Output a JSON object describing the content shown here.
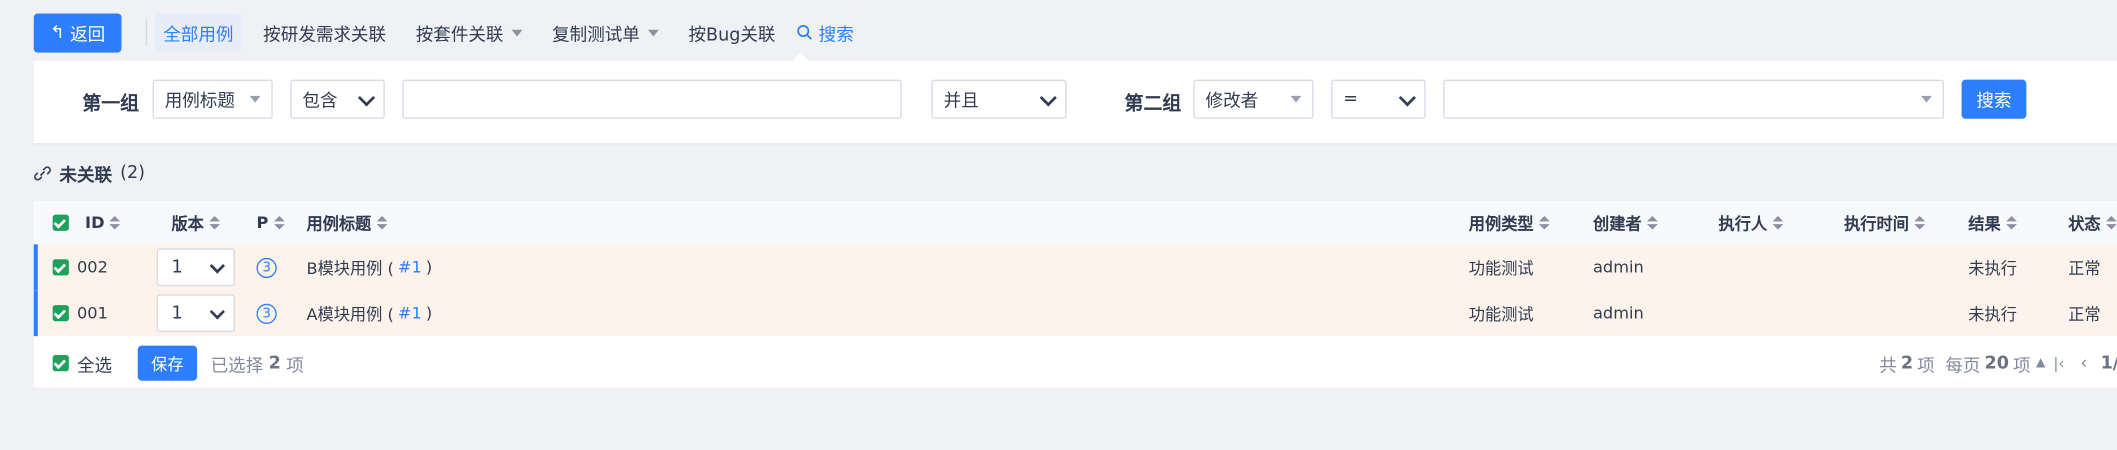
{
  "toolbar": {
    "back_label": "返回",
    "tabs": [
      "全部用例",
      "按研发需求关联",
      "按套件关联",
      "复制测试单",
      "按Bug关联"
    ],
    "search_label": "搜索"
  },
  "search_panel": {
    "group1_label": "第一组",
    "group1_field": "用例标题",
    "group1_operator": "包含",
    "group1_value": "",
    "logic": "并且",
    "group2_label": "第二组",
    "group2_field": "修改者",
    "group2_operator": "=",
    "group2_value": "",
    "search_button": "搜索"
  },
  "section": {
    "title": "未关联",
    "count": "(2)"
  },
  "table": {
    "headers": [
      "ID",
      "版本",
      "P",
      "用例标题",
      "用例类型",
      "创建者",
      "执行人",
      "执行时间",
      "结果",
      "状态"
    ],
    "rows": [
      {
        "id": "002",
        "version": "1",
        "priority": "3",
        "title": "B模块用例 (",
        "title_link": "#1",
        "title_end": ")",
        "type": "功能测试",
        "creator": "admin",
        "executor": "",
        "exec_time": "",
        "result": "未执行",
        "status": "正常"
      },
      {
        "id": "001",
        "version": "1",
        "priority": "3",
        "title": "A模块用例 (",
        "title_link": "#1",
        "title_end": ")",
        "type": "功能测试",
        "creator": "admin",
        "executor": "",
        "exec_time": "",
        "result": "未执行",
        "status": "正常"
      }
    ]
  },
  "footer": {
    "select_all": "全选",
    "save": "保存",
    "selected_prefix": "已选择",
    "selected_count": "2",
    "selected_suffix": "项",
    "total_prefix": "共",
    "total_count": "2",
    "total_suffix": "项",
    "per_page_prefix": "每页",
    "per_page_count": "20",
    "per_page_suffix": "项",
    "page": "1/"
  },
  "colors": {
    "primary": "#2e7fff",
    "check": "#1ea15b",
    "row_bg": "#fdf3ea"
  }
}
